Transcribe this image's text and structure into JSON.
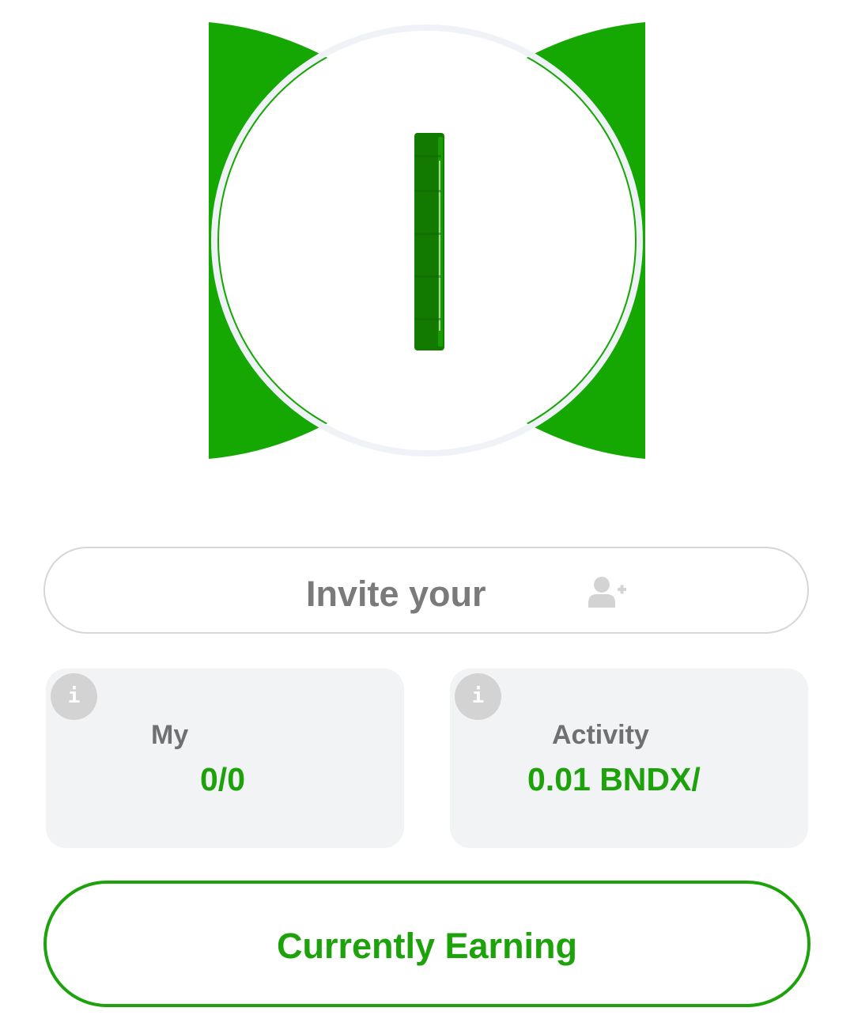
{
  "colors": {
    "brand_green": "#1da20b",
    "hero_green": "#15a802",
    "coin_green": "#157f00",
    "ring": "#eff3f8",
    "card_bg": "#f2f3f5",
    "muted_text": "#7a7a7a",
    "info_icon_bg": "#d3d3d3"
  },
  "hero": {
    "icon": "spinning-coin-icon"
  },
  "invite": {
    "label": "Invite your",
    "icon": "add-user-icon"
  },
  "stats": [
    {
      "label": "My",
      "value": "0/0",
      "icon": "info-icon"
    },
    {
      "label": "Activity",
      "value": "0.01 BNDX/",
      "icon": "info-icon"
    }
  ],
  "earning": {
    "label": "Currently Earning"
  }
}
